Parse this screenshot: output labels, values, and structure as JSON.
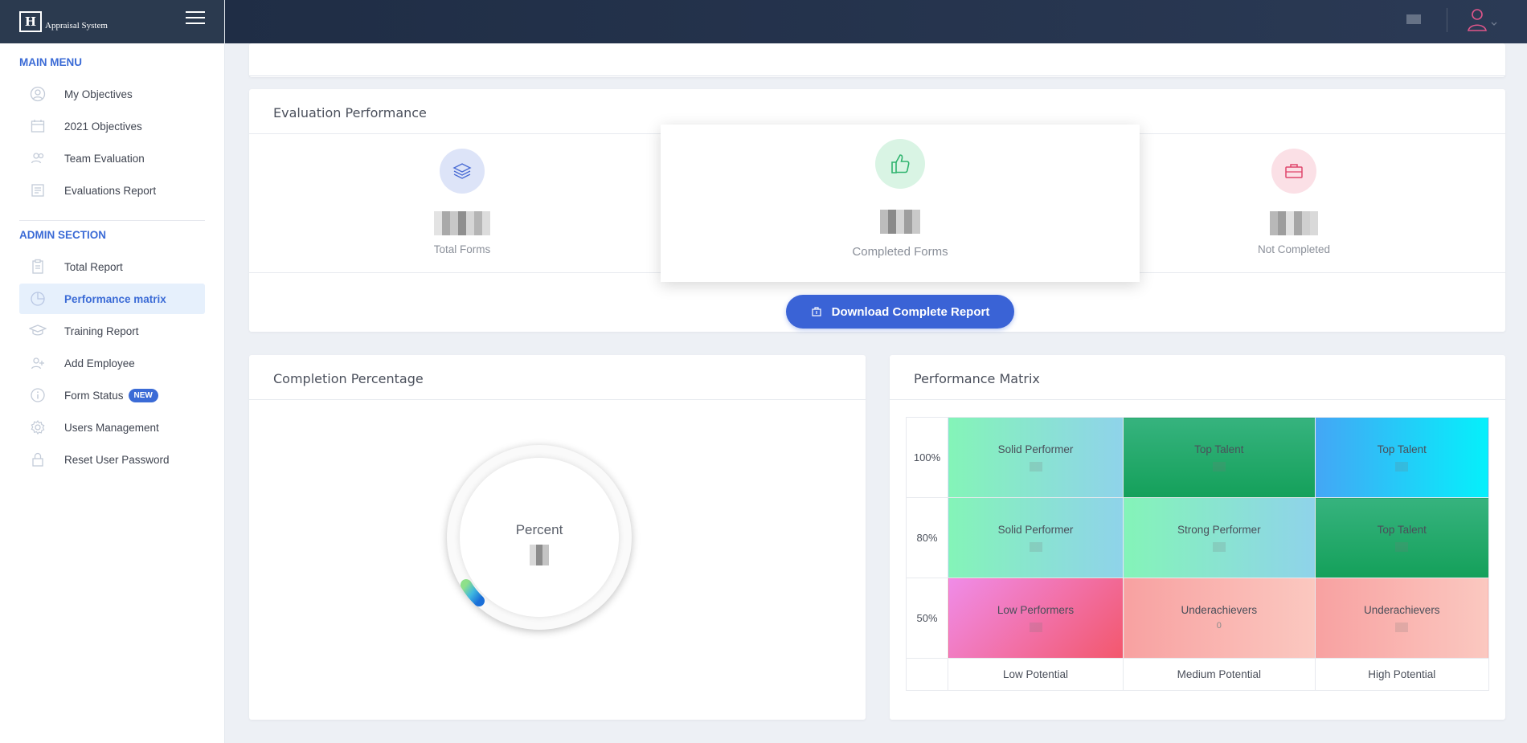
{
  "app": {
    "brand": "Appraisal System"
  },
  "sidebar": {
    "main_menu_title": "MAIN MENU",
    "main_items": [
      {
        "label": "My Objectives",
        "icon": "user-circle-icon"
      },
      {
        "label": "2021 Objectives",
        "icon": "calendar-icon"
      },
      {
        "label": "Team Evaluation",
        "icon": "users-icon"
      },
      {
        "label": "Evaluations Report",
        "icon": "report-icon"
      }
    ],
    "admin_title": "ADMIN SECTION",
    "admin_items": [
      {
        "label": "Total Report",
        "icon": "clipboard-icon"
      },
      {
        "label": "Performance matrix",
        "icon": "pie-chart-icon",
        "active": true
      },
      {
        "label": "Training Report",
        "icon": "graduation-cap-icon"
      },
      {
        "label": "Add Employee",
        "icon": "add-user-icon"
      },
      {
        "label": "Form Status",
        "icon": "info-icon",
        "badge": "NEW"
      },
      {
        "label": "Users Management",
        "icon": "gear-icon"
      },
      {
        "label": "Reset User Password",
        "icon": "lock-icon"
      }
    ]
  },
  "evaluation": {
    "title": "Evaluation Performance",
    "stats": [
      {
        "label": "Total Forms",
        "icon": "layers-icon",
        "color": "#4a6cd4"
      },
      {
        "label": "Completed Forms",
        "icon": "thumbs-up-icon",
        "color": "#2fb36e"
      },
      {
        "label": "Not Completed",
        "icon": "briefcase-icon",
        "color": "#e0456b"
      }
    ],
    "download_label": "Download Complete Report"
  },
  "completion": {
    "title": "Completion Percentage",
    "dial_label": "Percent"
  },
  "matrix": {
    "title": "Performance Matrix",
    "row_labels": [
      "100%",
      "80%",
      "50%"
    ],
    "col_labels": [
      "Low Potential",
      "Medium Potential",
      "High Potential"
    ],
    "cells": [
      [
        "Solid Performer",
        "Top Talent",
        "Top Talent"
      ],
      [
        "Solid Performer",
        "Strong Performer",
        "Top Talent"
      ],
      [
        "Low Performers",
        "Underachievers",
        "Underachievers"
      ]
    ],
    "underachievers_mid_value": "0"
  },
  "colors": {
    "accent": "#3b6bd6",
    "header": "#1f2d45",
    "active_bg": "#e6f0fc"
  }
}
